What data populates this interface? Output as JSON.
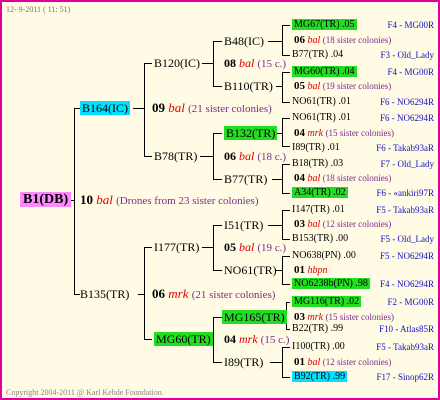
{
  "header": {
    "stamp": "12-  9-2011 ( 11: 51)"
  },
  "root": {
    "label": "B1(DB)",
    "num": "10",
    "gen": "bal",
    "note": "(Drones from 23 sister colonies)"
  },
  "l1": [
    {
      "label": "B164(IC)"
    },
    {
      "label": "B135(TR)",
      "num": "06",
      "gen": "mrk",
      "note": "(21 sister colonies)"
    }
  ],
  "l2": [
    {
      "label": "B120(IC)"
    },
    {
      "label": "B78(TR)"
    },
    {
      "label": "I177(TR)"
    },
    {
      "label": "MG60(TR)"
    }
  ],
  "l2_mid": [
    {
      "num": "09",
      "gen": "bal",
      "note": "(21 sister colonies)"
    },
    {
      "num": "04",
      "gen": "mrk",
      "note": "(15 c.)"
    }
  ],
  "l3": [
    {
      "label": "B48(IC)"
    },
    {
      "label": "B110(TR)"
    },
    {
      "label": "B132(TR)"
    },
    {
      "label": "B77(TR)"
    },
    {
      "label": "I51(TR)"
    },
    {
      "label": "NO61(TR)"
    },
    {
      "label": "MG165(TR)"
    },
    {
      "label": "I89(TR)"
    }
  ],
  "l3_mid": [
    {
      "num": "08",
      "gen": "bal",
      "note": "(15 c.)"
    },
    {
      "num": "06",
      "gen": "bal",
      "note": "(18 c.)"
    },
    {
      "num": "05",
      "gen": "bal",
      "note": "(19 c.)"
    }
  ],
  "l4": [
    {
      "a": "MG67(TR) .05",
      "b": "F4 - MG00R"
    },
    {
      "num": "06",
      "gen": "bal",
      "note": "(18 sister colonies)"
    },
    {
      "a": "B77(TR) .04",
      "b": "F3 - Old_Lady"
    },
    {
      "a": "MG60(TR) .04",
      "b": "F4 - MG00R"
    },
    {
      "num": "05",
      "gen": "bal",
      "note": "(19 sister colonies)"
    },
    {
      "a": "NO61(TR) .01",
      "b": "F6 - NO6294R"
    },
    {
      "a": "NO61(TR) .01",
      "b": "F6 - NO6294R"
    },
    {
      "num": "04",
      "gen": "mrk",
      "note": "(15 sister colonies)"
    },
    {
      "a": "I89(TR) .01",
      "b": "F6 - Takab93aR"
    },
    {
      "a": "B18(TR) .03",
      "b": "F7 - Old_Lady"
    },
    {
      "num": "04",
      "gen": "bal",
      "note": "(18 sister colonies)"
    },
    {
      "a": "A34(TR) .02",
      "b": "F6 - «ankiri97R"
    },
    {
      "a": "I147(TR) .01",
      "b": "F5 - Takab93aR"
    },
    {
      "num": "03",
      "gen": "bal",
      "note": "(12 sister colonies)"
    },
    {
      "a": "B153(TR) .00",
      "b": "F5 - Old_Lady"
    },
    {
      "a": "NO638(PN) .00",
      "b": "F5 - NO6294R"
    },
    {
      "num": "01",
      "gen": "hbpn",
      "note": ""
    },
    {
      "a": "NO6238b(PN) .98",
      "b": "F4 - NO6294R"
    },
    {
      "a": "MG116(TR) .02",
      "b": "F2 - MG00R"
    },
    {
      "num": "03",
      "gen": "mrk",
      "note": "(15 sister colonies)"
    },
    {
      "a": "B22(TR) .99",
      "b": "F10 - Atlas85R"
    },
    {
      "a": "I100(TR) .00",
      "b": "F5 - Takab93aR"
    },
    {
      "num": "01",
      "gen": "bal",
      "note": "(12 sister colonies)"
    },
    {
      "a": "B92(TR) .99",
      "b": "F17 - Sinop62R"
    }
  ],
  "footer": {
    "copyright": "Copyright 2004-2011 @ Karl Kehde Foundation."
  },
  "colors": {
    "border": "#e000a0",
    "background": "#fffbe4",
    "green": "#22dd22",
    "cyan": "#00e0ff",
    "magenta": "#ff88ff",
    "code_blue": "#1010c8",
    "gen_red": "#e00000"
  }
}
